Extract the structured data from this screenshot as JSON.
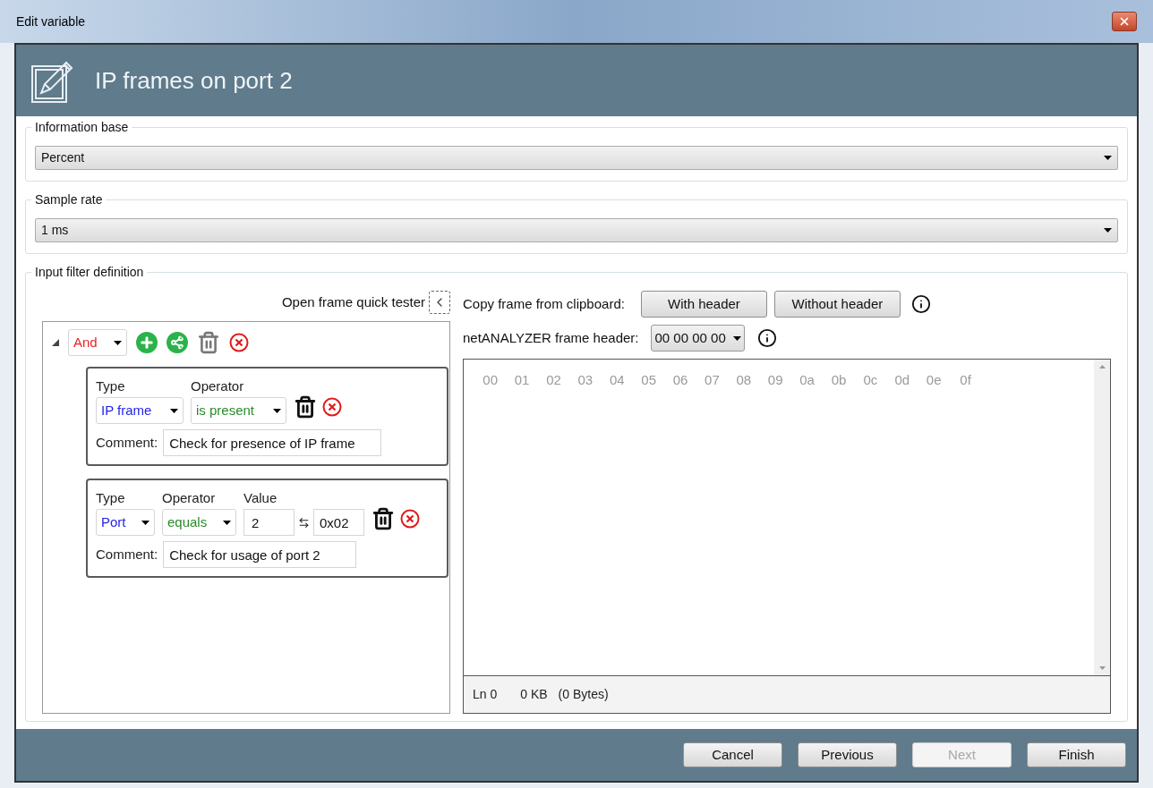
{
  "window": {
    "title": "Edit variable"
  },
  "header": {
    "title": "IP frames on port 2"
  },
  "information_base": {
    "label": "Information base",
    "value": "Percent"
  },
  "sample_rate": {
    "label": "Sample rate",
    "value": "1 ms"
  },
  "filter": {
    "label": "Input filter definition",
    "quick_tester_label": "Open frame quick tester",
    "tree": {
      "operator": "And",
      "expanded": true,
      "conditions": [
        {
          "type_label": "Type",
          "type": "IP frame",
          "operator_label": "Operator",
          "operator": "is present",
          "comment_label": "Comment:",
          "comment": "Check for presence of IP frame"
        },
        {
          "type_label": "Type",
          "type": "Port",
          "operator_label": "Operator",
          "operator": "equals",
          "value_label": "Value",
          "value": "2",
          "hex": "0x02",
          "comment_label": "Comment:",
          "comment": "Check for usage of port 2"
        }
      ]
    }
  },
  "frame_panel": {
    "copy_label": "Copy frame from clipboard:",
    "copy_buttons": [
      "With header",
      "Without header"
    ],
    "header_label": "netANALYZER frame header:",
    "header_value": "00 00 00 00",
    "columns": [
      "00",
      "01",
      "02",
      "03",
      "04",
      "05",
      "06",
      "07",
      "08",
      "09",
      "0a",
      "0b",
      "0c",
      "0d",
      "0e",
      "0f"
    ],
    "status": {
      "line": "Ln 0",
      "size": "0 KB",
      "bytes": "(0 Bytes)"
    }
  },
  "buttons": [
    {
      "label": "Cancel",
      "disabled": false
    },
    {
      "label": "Previous",
      "disabled": false
    },
    {
      "label": "Next",
      "disabled": true
    },
    {
      "label": "Finish",
      "disabled": false
    }
  ]
}
